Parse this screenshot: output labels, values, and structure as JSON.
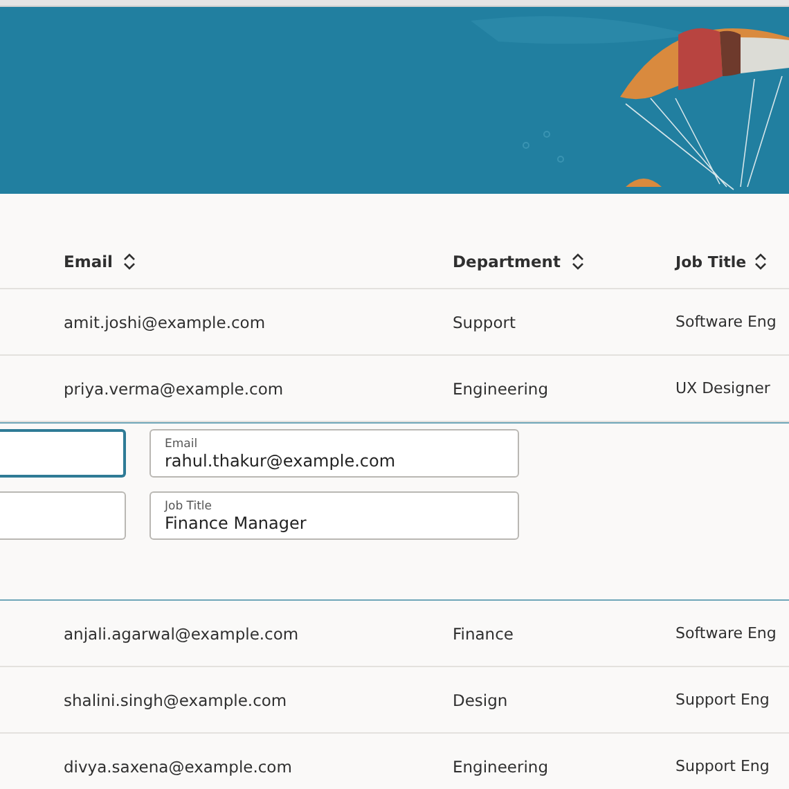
{
  "table": {
    "columns": [
      {
        "label": "Email",
        "sortable": true
      },
      {
        "label": "Department",
        "sortable": true
      },
      {
        "label": "Job Title",
        "sortable": true
      }
    ],
    "rows": [
      {
        "kind": "row",
        "cells": [
          "amit.joshi@example.com",
          "Support",
          "Software Eng"
        ]
      },
      {
        "kind": "row",
        "cells": [
          "priya.verma@example.com",
          "Engineering",
          "UX Designer"
        ]
      },
      {
        "kind": "edit",
        "fields": [
          {
            "focused": true
          },
          {
            "label": "Email",
            "value": "rahul.thakur@example.com",
            "focused": false
          },
          {
            "focused": false
          },
          {
            "label": "Job Title",
            "value": "Finance Manager",
            "focused": false
          }
        ]
      },
      {
        "kind": "row",
        "cells": [
          "anjali.agarwal@example.com",
          "Finance",
          "Software Eng"
        ]
      },
      {
        "kind": "row",
        "cells": [
          "shalini.singh@example.com",
          "Design",
          "Support Eng"
        ]
      },
      {
        "kind": "row",
        "cells": [
          "divya.saxena@example.com",
          "Engineering",
          "Support Eng"
        ]
      }
    ]
  }
}
